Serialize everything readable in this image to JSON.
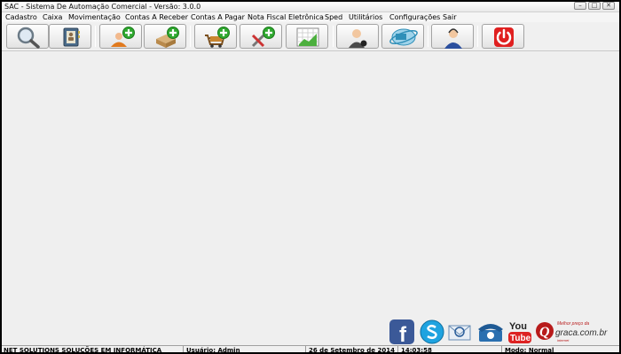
{
  "window": {
    "title": "SAC - Sistema De Automação Comercial - Versão: 3.0.0",
    "controls": {
      "minimize": "–",
      "maximize": "□",
      "close": "✕"
    }
  },
  "menu": [
    "Cadastro",
    "Caixa",
    "Movimentação",
    "Contas A Receber",
    "Contas A Pagar",
    "Nota Fiscal Eletrônica",
    "Sped",
    "Utilitários",
    "Configurações",
    "Sair"
  ],
  "toolbar_icons": [
    "search-icon",
    "address-book-icon",
    "add-client-icon",
    "add-product-icon",
    "add-sale-icon",
    "add-service-icon",
    "spreadsheet-icon",
    "user-icon",
    "nfe-icon",
    "support-icon",
    "power-icon"
  ],
  "social": {
    "facebook": "f",
    "youtube_top": "You",
    "youtube_bottom": "Tube",
    "brand_small": "Melhor preço da",
    "brand_main": "graca.com.br",
    "brand_sub": "internet"
  },
  "status": {
    "company": "NET SOLUTIONS SOLUÇÕES EM INFORMÁTICA",
    "user": "Usuário: Admin",
    "date": "26 de Setembro de 2014",
    "time": "14:03:58",
    "mode": "Modo: Normal"
  },
  "colors": {
    "green_plus": "#2fa82f",
    "power_red": "#e02020",
    "skype_blue": "#1fa3e0",
    "facebook_blue": "#3b5998",
    "youtube_red": "#d22"
  }
}
